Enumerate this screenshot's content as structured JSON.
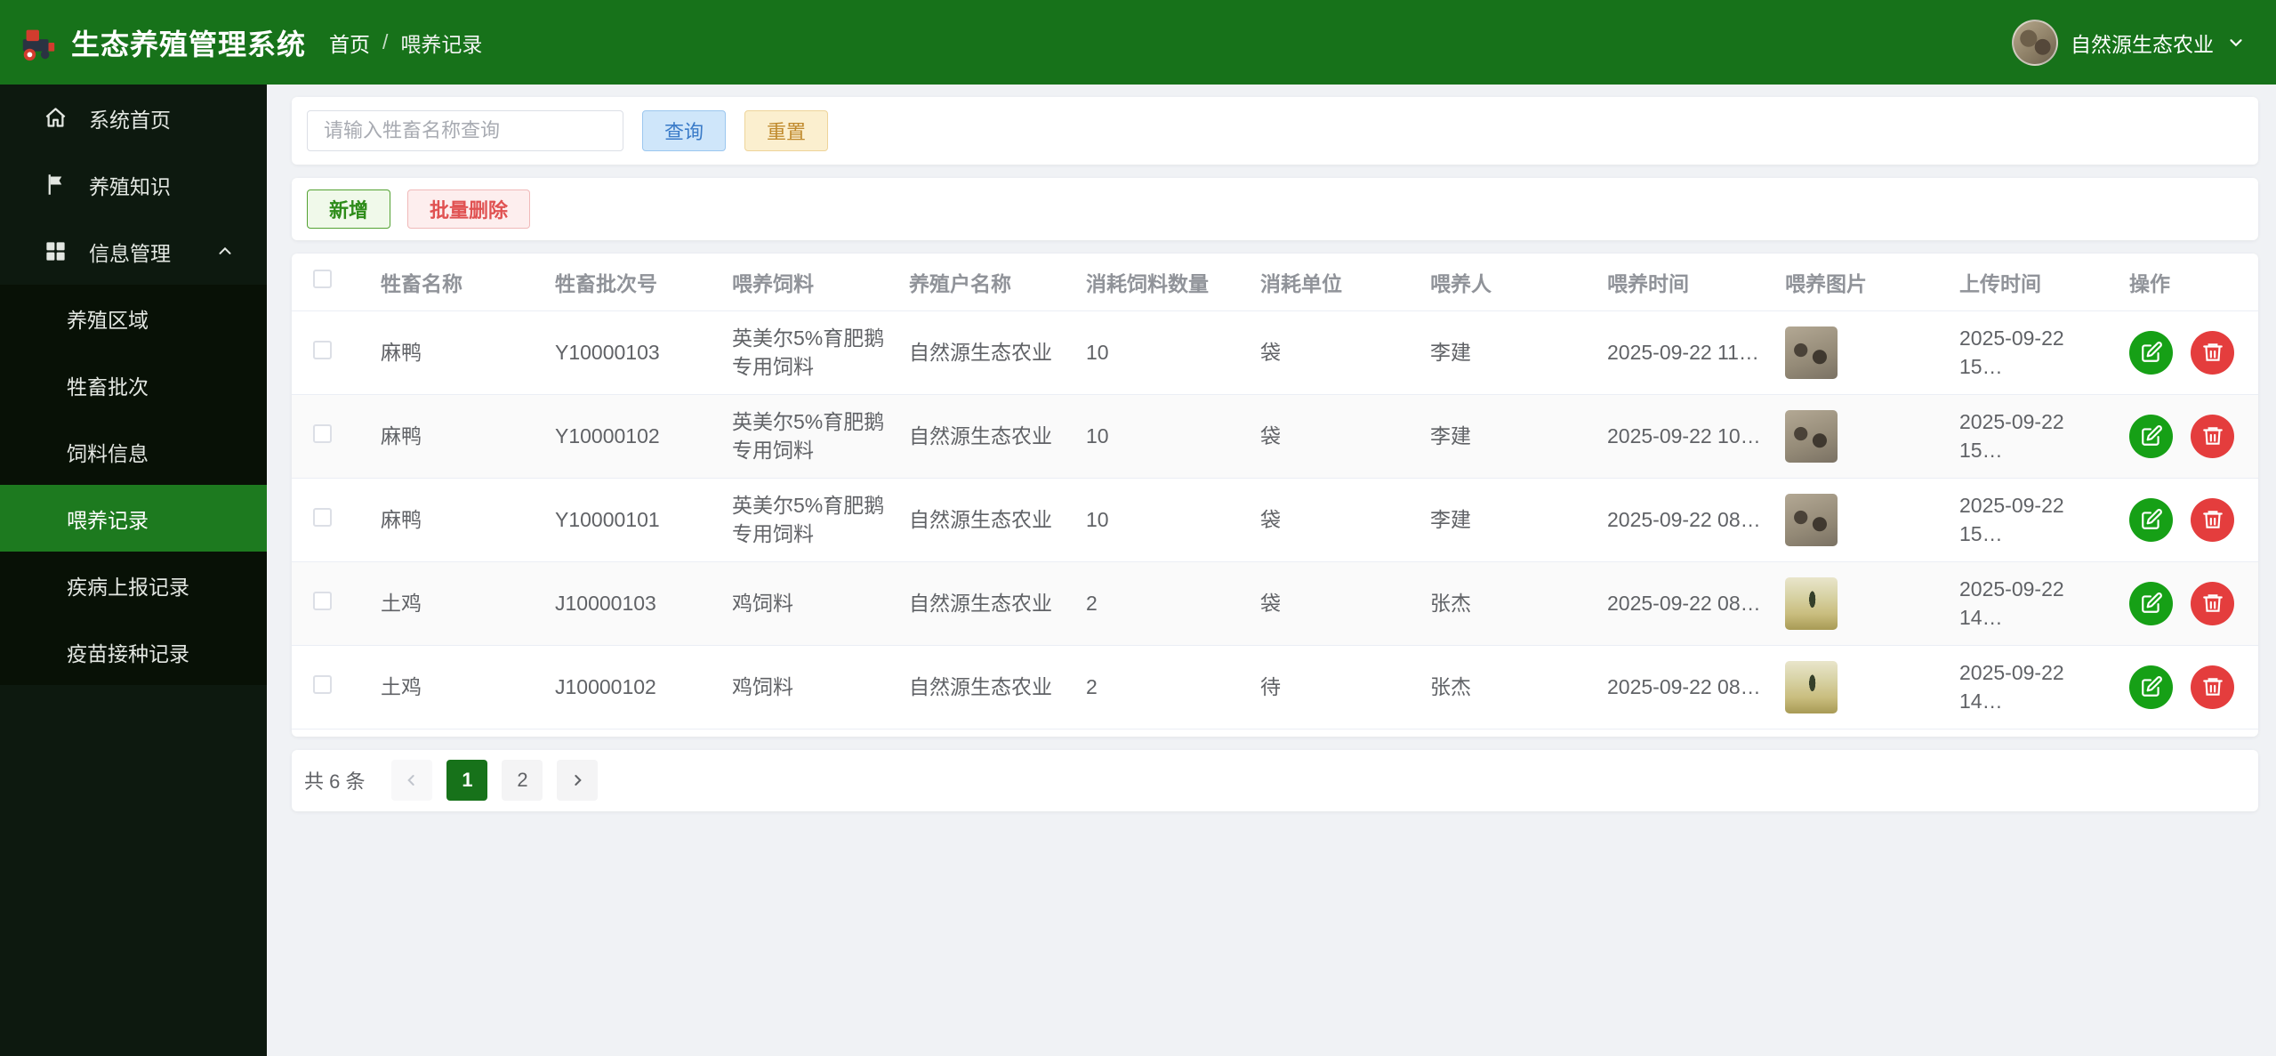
{
  "app": {
    "title": "生态养殖管理系统"
  },
  "breadcrumb": {
    "home": "首页",
    "sep": "/",
    "current": "喂养记录"
  },
  "user": {
    "org_name": "自然源生态农业"
  },
  "colors": {
    "header_green": "#17721a",
    "sidebar_dark": "#0d190f",
    "active_menu_green": "#1d7a1f",
    "edit_green": "#16a016",
    "delete_red": "#e43d3d"
  },
  "sidebar": {
    "items": [
      {
        "label": "系统首页",
        "icon": "home-icon"
      },
      {
        "label": "养殖知识",
        "icon": "flag-icon"
      },
      {
        "label": "信息管理",
        "icon": "grid-icon",
        "expanded": true
      }
    ],
    "submenu": [
      {
        "label": "养殖区域"
      },
      {
        "label": "牲畜批次"
      },
      {
        "label": "饲料信息"
      },
      {
        "label": "喂养记录",
        "active": true
      },
      {
        "label": "疾病上报记录"
      },
      {
        "label": "疫苗接种记录"
      }
    ]
  },
  "search": {
    "placeholder": "请输入牲畜名称查询",
    "query": "查询",
    "reset": "重置"
  },
  "toolbar": {
    "add": "新增",
    "batch_delete": "批量删除"
  },
  "table": {
    "columns": [
      "牲畜名称",
      "牲畜批次号",
      "喂养饲料",
      "养殖户名称",
      "消耗饲料数量",
      "消耗单位",
      "喂养人",
      "喂养时间",
      "喂养图片",
      "上传时间",
      "操作"
    ],
    "rows": [
      {
        "name": "麻鸭",
        "batch": "Y10000103",
        "feed": "英美尔5%育肥鹅专用饲料",
        "farmer": "自然源生态农业",
        "quantity": "10",
        "unit": "袋",
        "feeder": "李建",
        "feed_time": "2025-09-22 11…",
        "image": "duck-photo",
        "upload_time": "2025-09-22 15…"
      },
      {
        "name": "麻鸭",
        "batch": "Y10000102",
        "feed": "英美尔5%育肥鹅专用饲料",
        "farmer": "自然源生态农业",
        "quantity": "10",
        "unit": "袋",
        "feeder": "李建",
        "feed_time": "2025-09-22 10…",
        "image": "duck-photo",
        "upload_time": "2025-09-22 15…"
      },
      {
        "name": "麻鸭",
        "batch": "Y10000101",
        "feed": "英美尔5%育肥鹅专用饲料",
        "farmer": "自然源生态农业",
        "quantity": "10",
        "unit": "袋",
        "feeder": "李建",
        "feed_time": "2025-09-22 08…",
        "image": "duck-photo",
        "upload_time": "2025-09-22 15…"
      },
      {
        "name": "土鸡",
        "batch": "J10000103",
        "feed": "鸡饲料",
        "farmer": "自然源生态农业",
        "quantity": "2",
        "unit": "袋",
        "feeder": "张杰",
        "feed_time": "2025-09-22 08…",
        "image": "field-photo",
        "upload_time": "2025-09-22 14…"
      },
      {
        "name": "土鸡",
        "batch": "J10000102",
        "feed": "鸡饲料",
        "farmer": "自然源生态农业",
        "quantity": "2",
        "unit": "待",
        "feeder": "张杰",
        "feed_time": "2025-09-22 08…",
        "image": "field-photo",
        "upload_time": "2025-09-22 14…"
      }
    ]
  },
  "pagination": {
    "total": "共 6 条",
    "page1": "1",
    "page2": "2"
  }
}
